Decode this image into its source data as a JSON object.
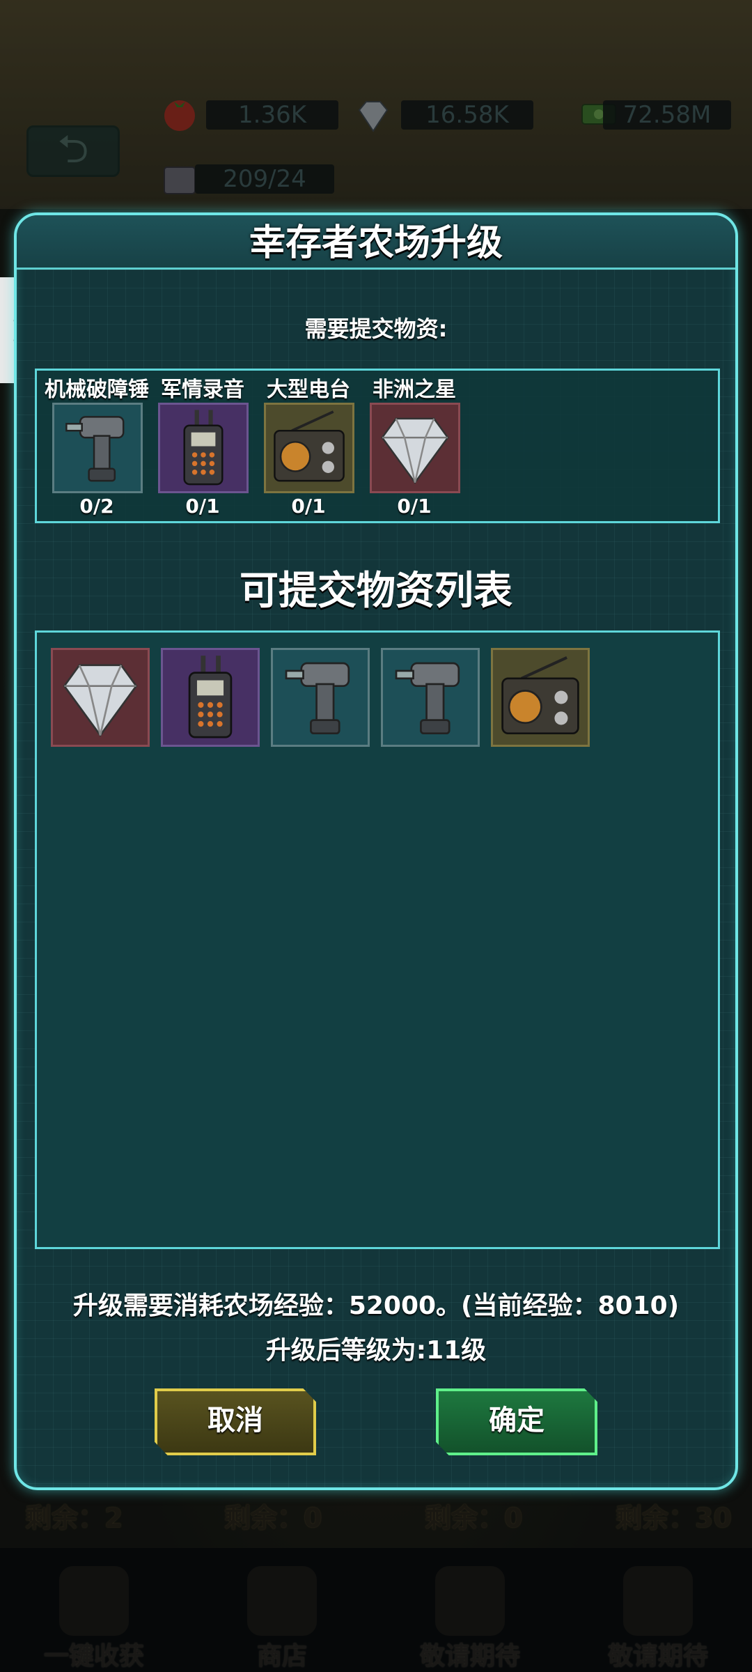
{
  "hud": {
    "tomatoes": "1.36K",
    "diamonds": "16.58K",
    "cash": "72.58M",
    "capacity": "209/24"
  },
  "dialog": {
    "title": "幸存者农场升级",
    "need_label": "需要提交物资:",
    "required_items": [
      {
        "name": "机械破障锤",
        "count": "0/2",
        "icon": "drill-icon",
        "tile": "teal"
      },
      {
        "name": "军情录音",
        "count": "0/1",
        "icon": "walkie-talkie-icon",
        "tile": "purple"
      },
      {
        "name": "大型电台",
        "count": "0/1",
        "icon": "radio-icon",
        "tile": "olive"
      },
      {
        "name": "非洲之星",
        "count": "0/1",
        "icon": "diamond-icon",
        "tile": "red"
      }
    ],
    "list_title": "可提交物资列表",
    "available_items": [
      {
        "icon": "diamond-icon",
        "tile": "red"
      },
      {
        "icon": "walkie-talkie-icon",
        "tile": "purple"
      },
      {
        "icon": "drill-icon",
        "tile": "teal"
      },
      {
        "icon": "drill-icon",
        "tile": "teal"
      },
      {
        "icon": "radio-icon",
        "tile": "olive"
      }
    ],
    "upgrade_cost": "升级需要消耗农场经验：52000。(当前经验：8010)",
    "upgrade_result": "升级后等级为:11级",
    "cancel_label": "取消",
    "confirm_label": "确定"
  },
  "remaining": [
    "剩余：2",
    "剩余：0",
    "剩余：0",
    "剩余：30"
  ],
  "bottom_nav": [
    {
      "label": "一键收获"
    },
    {
      "label": "商店"
    },
    {
      "label": "敬请期待"
    },
    {
      "label": "敬请期待"
    }
  ],
  "colors": {
    "accent": "#6fe6e6",
    "cancel": "#e0cc4a",
    "confirm": "#5ff08a"
  }
}
